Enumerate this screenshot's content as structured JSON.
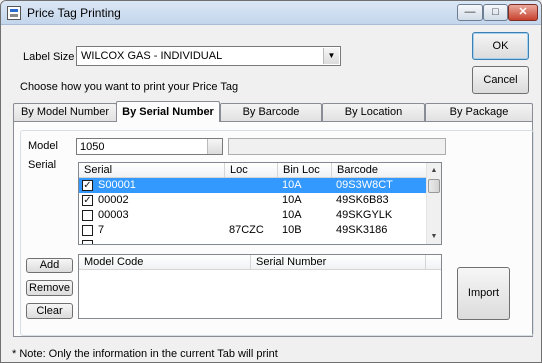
{
  "window": {
    "title": "Price Tag Printing",
    "minimize_glyph": "—",
    "maximize_glyph": "□",
    "close_glyph": "✕"
  },
  "actions": {
    "ok_label": "OK",
    "cancel_label": "Cancel",
    "import_label": "Import",
    "add_label": "Add",
    "remove_label": "Remove",
    "clear_label": "Clear"
  },
  "label_size": {
    "label": "Label Size",
    "value": "WILCOX GAS - INDIVIDUAL"
  },
  "instruction": "Choose how you want to print your Price Tag",
  "tabs": [
    {
      "label": "By Model Number",
      "active": false
    },
    {
      "label": "By Serial Number",
      "active": true
    },
    {
      "label": "By Barcode",
      "active": false
    },
    {
      "label": "By Location",
      "active": false
    },
    {
      "label": "By Package",
      "active": false
    }
  ],
  "model": {
    "label": "Model",
    "value": "1050",
    "description": ""
  },
  "serial": {
    "label": "Serial",
    "columns": [
      "Serial",
      "Loc",
      "Bin Loc",
      "Barcode"
    ],
    "rows": [
      {
        "checked": true,
        "serial": "S00001",
        "loc": "",
        "bin_loc": "10A",
        "barcode": "09S3W8CT",
        "selected": true
      },
      {
        "checked": true,
        "serial": "00002",
        "loc": "",
        "bin_loc": "10A",
        "barcode": "49SK6B83",
        "selected": false
      },
      {
        "checked": false,
        "serial": "00003",
        "loc": "",
        "bin_loc": "10A",
        "barcode": "49SKGYLK",
        "selected": false
      },
      {
        "checked": false,
        "serial": "7",
        "loc": "87CZC",
        "bin_loc": "10B",
        "barcode": "49SK3186",
        "selected": false
      }
    ]
  },
  "selected_list": {
    "columns": [
      "Model Code",
      "Serial Number"
    ]
  },
  "footer_note": "* Note: Only the information in the current Tab will print"
}
